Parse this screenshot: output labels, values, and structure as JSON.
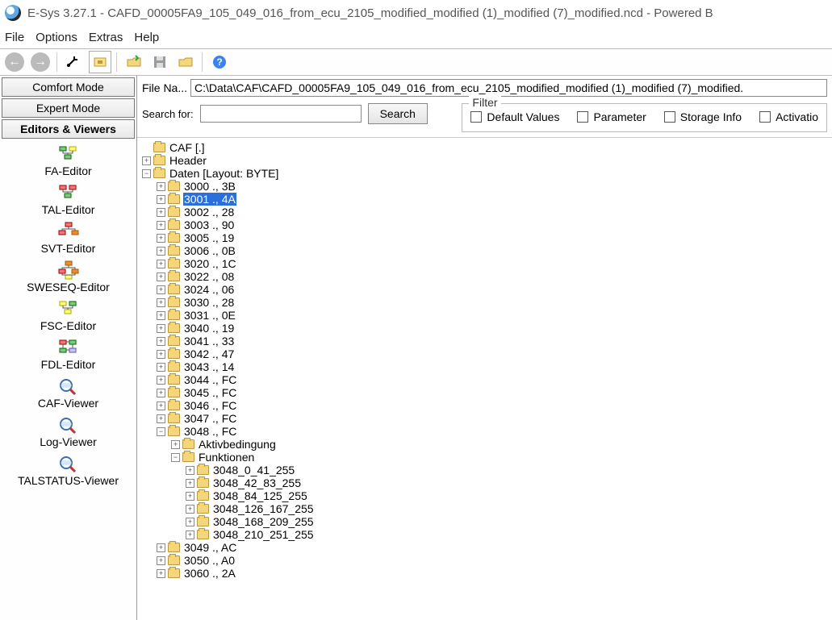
{
  "window": {
    "title": "E-Sys 3.27.1 - CAFD_00005FA9_105_049_016_from_ecu_2105_modified_modified (1)_modified (7)_modified.ncd   - Powered B"
  },
  "menu": {
    "file": "File",
    "options": "Options",
    "extras": "Extras",
    "help": "Help"
  },
  "sidebar": {
    "comfort": "Comfort Mode",
    "expert": "Expert Mode",
    "editors_viewers": "Editors & Viewers",
    "items": [
      {
        "label": "FA-Editor"
      },
      {
        "label": "TAL-Editor"
      },
      {
        "label": "SVT-Editor"
      },
      {
        "label": "SWESEQ-Editor"
      },
      {
        "label": "FSC-Editor"
      },
      {
        "label": "FDL-Editor"
      },
      {
        "label": "CAF-Viewer"
      },
      {
        "label": "Log-Viewer"
      },
      {
        "label": "TALSTATUS-Viewer"
      }
    ]
  },
  "form": {
    "filename_label": "File Na...",
    "filename_value": "C:\\Data\\CAF\\CAFD_00005FA9_105_049_016_from_ecu_2105_modified_modified (1)_modified (7)_modified.",
    "search_label": "Search for:",
    "search_btn": "Search",
    "filter_legend": "Filter",
    "filter_default": "Default Values",
    "filter_parameter": "Parameter",
    "filter_storage": "Storage Info",
    "filter_activation": "Activatio"
  },
  "tree": {
    "root": "CAF [.]",
    "header": "Header",
    "daten": "Daten [Layout: BYTE]",
    "nodes": [
      "3000 ., 3B",
      "3001 ., 4A",
      "3002 ., 28",
      "3003 ., 90",
      "3005 ., 19",
      "3006 ., 0B",
      "3020 ., 1C",
      "3022 ., 08",
      "3024 ., 06",
      "3030 ., 28",
      "3031 ., 0E",
      "3040 ., 19",
      "3041 ., 33",
      "3042 ., 47",
      "3043 ., 14",
      "3044 ., FC",
      "3045 ., FC",
      "3046 ., FC",
      "3047 ., FC",
      "3048 ., FC"
    ],
    "sub3048": {
      "aktiv": "Aktivbedingung",
      "funkt": "Funktionen",
      "fnodes": [
        "3048_0_41_255",
        "3048_42_83_255",
        "3048_84_125_255",
        "3048_126_167_255",
        "3048_168_209_255",
        "3048_210_251_255"
      ]
    },
    "tail": [
      "3049 ., AC",
      "3050 ., A0",
      "3060 ., 2A"
    ]
  }
}
